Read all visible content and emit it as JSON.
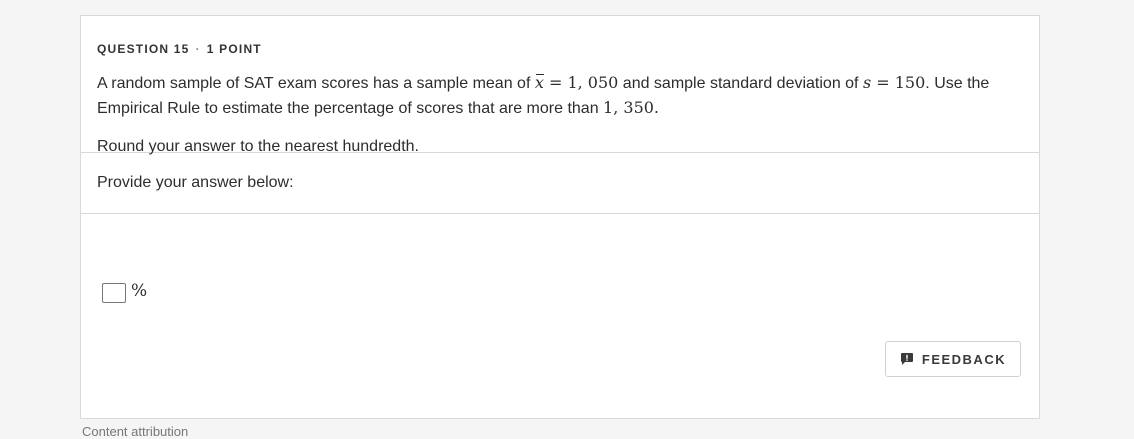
{
  "question": {
    "number_label": "QUESTION 15",
    "separator": "·",
    "points_label": "1 POINT",
    "text_part1": "A random sample of SAT exam scores has a sample mean of ",
    "mean_symbol": "x",
    "equals": " = ",
    "mean_value": "1, 050",
    "text_part2": " and sample standard deviation of ",
    "sd_symbol": "s",
    "sd_value": "150",
    "text_part3": ".  Use the Empirical Rule to estimate the percentage of scores that are more than ",
    "threshold_value": "1, 350",
    "text_part4": ".",
    "instruction": "Round your answer to the nearest hundredth."
  },
  "answer": {
    "label": "Provide your answer below:",
    "value": "",
    "unit": "%"
  },
  "feedback": {
    "label": "FEEDBACK",
    "icon": "feedback-icon"
  },
  "footer": {
    "text": "Content attribution"
  }
}
